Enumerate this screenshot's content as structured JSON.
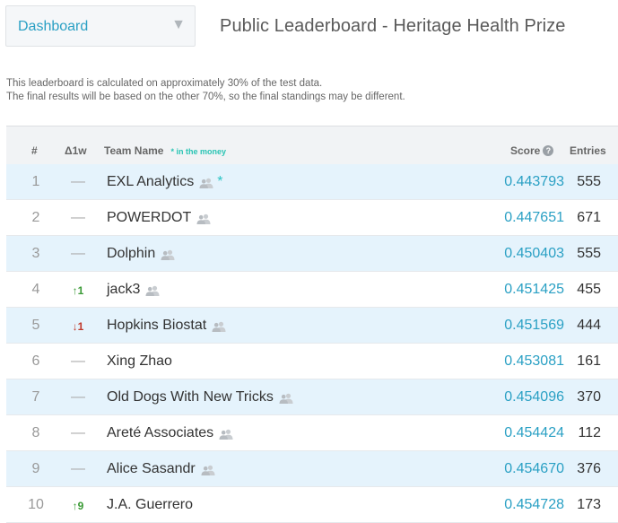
{
  "dropdown": {
    "label": "Dashboard",
    "arrow_icon": "caret-down-icon"
  },
  "page_title": "Public Leaderboard - Heritage Health Prize",
  "note": {
    "line1": "This leaderboard is calculated on approximately 30% of the test data.",
    "line2": "The final results will be based on the other 70%, so the final standings may be different."
  },
  "table": {
    "headers": {
      "rank": "#",
      "delta": "Δ1w",
      "team": "Team Name",
      "money_note": "* in the money",
      "score": "Score",
      "entries": "Entries"
    },
    "colors": {
      "accent": "#2aa0c4",
      "alt_row": "#e5f3fc",
      "up": "#3a9a35",
      "down": "#c0392b"
    },
    "rows": [
      {
        "rank": "1",
        "delta": "—",
        "delta_dir": "none",
        "team": "EXL Analytics",
        "team_icon": true,
        "money": "*",
        "score": "0.443793",
        "entries": "555"
      },
      {
        "rank": "2",
        "delta": "—",
        "delta_dir": "none",
        "team": "POWERDOT",
        "team_icon": true,
        "money": "",
        "score": "0.447651",
        "entries": "671"
      },
      {
        "rank": "3",
        "delta": "—",
        "delta_dir": "none",
        "team": "Dolphin",
        "team_icon": true,
        "money": "",
        "score": "0.450403",
        "entries": "555"
      },
      {
        "rank": "4",
        "delta": "↑1",
        "delta_dir": "up",
        "team": "jack3",
        "team_icon": true,
        "money": "",
        "score": "0.451425",
        "entries": "455"
      },
      {
        "rank": "5",
        "delta": "↓1",
        "delta_dir": "down",
        "team": "Hopkins Biostat",
        "team_icon": true,
        "money": "",
        "score": "0.451569",
        "entries": "444"
      },
      {
        "rank": "6",
        "delta": "—",
        "delta_dir": "none",
        "team": "Xing Zhao",
        "team_icon": false,
        "money": "",
        "score": "0.453081",
        "entries": "161"
      },
      {
        "rank": "7",
        "delta": "—",
        "delta_dir": "none",
        "team": "Old Dogs With New Tricks",
        "team_icon": true,
        "money": "",
        "score": "0.454096",
        "entries": "370"
      },
      {
        "rank": "8",
        "delta": "—",
        "delta_dir": "none",
        "team": "Areté Associates",
        "team_icon": true,
        "money": "",
        "score": "0.454424",
        "entries": "112"
      },
      {
        "rank": "9",
        "delta": "—",
        "delta_dir": "none",
        "team": "Alice Sasandr",
        "team_icon": true,
        "money": "",
        "score": "0.454670",
        "entries": "376"
      },
      {
        "rank": "10",
        "delta": "↑9",
        "delta_dir": "up",
        "team": "J.A. Guerrero",
        "team_icon": false,
        "money": "",
        "score": "0.454728",
        "entries": "173"
      }
    ]
  }
}
